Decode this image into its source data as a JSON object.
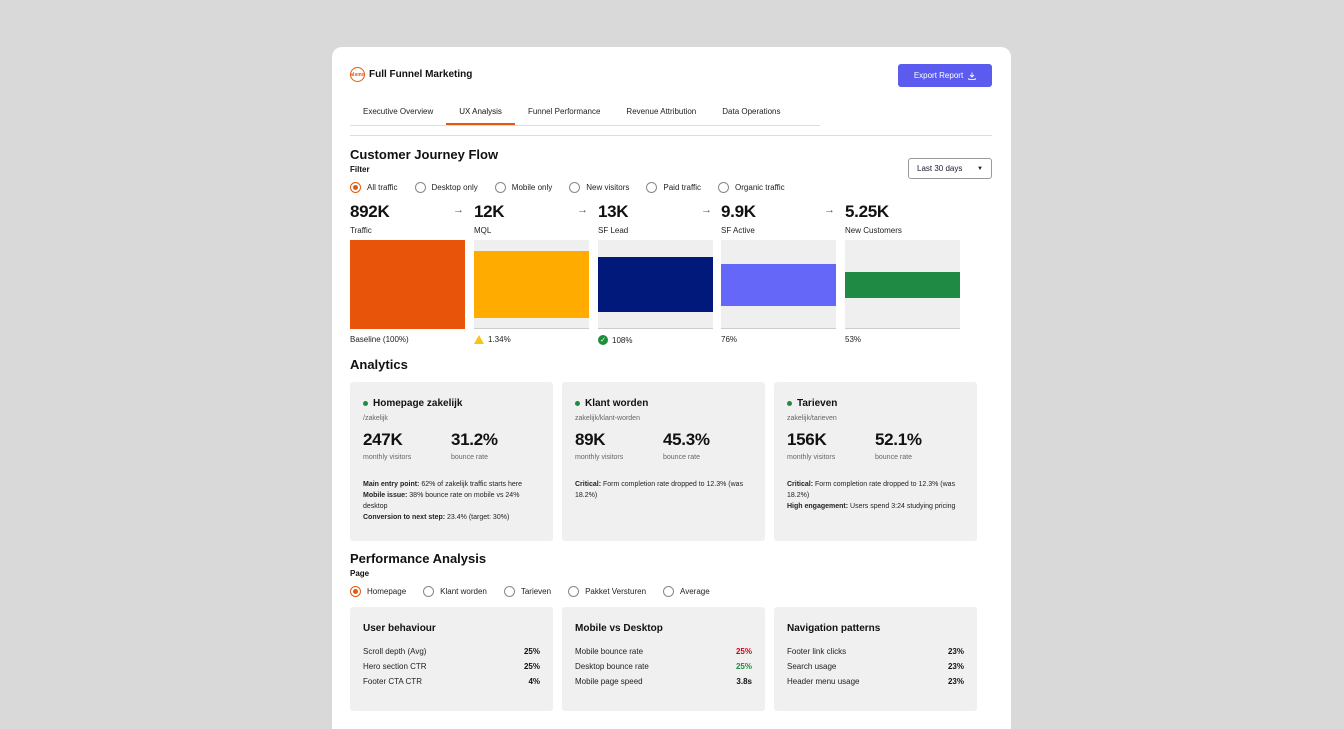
{
  "header": {
    "title": "Full Funnel Marketing",
    "logo_text": "alsmo",
    "export_label": "Export Report"
  },
  "tabs": [
    {
      "label": "Executive Overview"
    },
    {
      "label": "UX Analysis"
    },
    {
      "label": "Funnel Performance"
    },
    {
      "label": "Revenue Attribution"
    },
    {
      "label": "Data Operations"
    }
  ],
  "journey": {
    "title": "Customer Journey Flow",
    "filter_label": "Filter",
    "date_range": "Last 30 days",
    "filters": [
      "All traffic",
      "Desktop only",
      "Mobile only",
      "New visitors",
      "Paid traffic",
      "Organic traffic"
    ],
    "stages": [
      {
        "value": "892K",
        "label": "Traffic",
        "foot": "Baseline (100%)",
        "color": "#e8540a",
        "bar_fraction": 1.0
      },
      {
        "value": "12K",
        "label": "MQL",
        "foot": "1.34%",
        "color": "#ffab00",
        "bar_fraction": 0.75
      },
      {
        "value": "13K",
        "label": "SF Lead",
        "foot": "108%",
        "color": "#00197a",
        "bar_fraction": 0.62
      },
      {
        "value": "9.9K",
        "label": "SF Active",
        "foot": "76%",
        "color": "#6467f7",
        "bar_fraction": 0.47
      },
      {
        "value": "5.25K",
        "label": "New Customers",
        "foot": "53%",
        "color": "#1e8a44",
        "bar_fraction": 0.29
      }
    ]
  },
  "analytics": {
    "title": "Analytics",
    "cards": [
      {
        "title": "Homepage zakelijk",
        "path": "/zakelijk",
        "visitors": "247K",
        "visitors_label": "monthly visitors",
        "bounce": "31.2%",
        "bounce_label": "bounce rate",
        "notes": [
          {
            "k": "Main entry point:",
            "v": " 62% of zakelijk traffic starts here"
          },
          {
            "k": "Mobile issue:",
            "v": " 38% bounce rate on mobile vs 24% desktop"
          },
          {
            "k": "Conversion to next step:",
            "v": " 23.4% (target: 30%)"
          }
        ]
      },
      {
        "title": "Klant worden",
        "path": "zakelijk/klant-worden",
        "visitors": "89K",
        "visitors_label": "monthly visitors",
        "bounce": "45.3%",
        "bounce_label": "bounce rate",
        "notes": [
          {
            "k": "Critical:",
            "v": " Form completion rate dropped to 12.3% (was 18.2%)"
          }
        ]
      },
      {
        "title": "Tarieven",
        "path": "zakelijk/tarieven",
        "visitors": "156K",
        "visitors_label": "monthly visitors",
        "bounce": "52.1%",
        "bounce_label": "bounce rate",
        "notes": [
          {
            "k": "Critical:",
            "v": " Form completion rate dropped to 12.3% (was 18.2%)"
          },
          {
            "k": "High engagement:",
            "v": " Users spend 3:24 studying pricing"
          }
        ]
      }
    ]
  },
  "performance": {
    "title": "Performance Analysis",
    "page_label": "Page",
    "pages": [
      "Homepage",
      "Klant worden",
      "Tarieven",
      "Pakket Versturen",
      "Average"
    ],
    "cards": [
      {
        "title": "User behaviour",
        "rows": [
          {
            "k": "Scroll depth (Avg)",
            "v": "25%",
            "color": "#111111"
          },
          {
            "k": "Hero section CTR",
            "v": "25%",
            "color": "#111111"
          },
          {
            "k": "Footer CTA CTR",
            "v": "4%",
            "color": "#111111"
          }
        ]
      },
      {
        "title": "Mobile vs Desktop",
        "rows": [
          {
            "k": "Mobile bounce rate",
            "v": "25%",
            "color": "#d0021b"
          },
          {
            "k": "Desktop bounce rate",
            "v": "25%",
            "color": "#1e8e3e"
          },
          {
            "k": "Mobile page speed",
            "v": "3.8s",
            "color": "#111111"
          }
        ]
      },
      {
        "title": "Navigation patterns",
        "rows": [
          {
            "k": "Footer link clicks",
            "v": "23%",
            "color": "#111111"
          },
          {
            "k": "Search usage",
            "v": "23%",
            "color": "#111111"
          },
          {
            "k": "Header menu usage",
            "v": "23%",
            "color": "#111111"
          }
        ]
      }
    ]
  }
}
